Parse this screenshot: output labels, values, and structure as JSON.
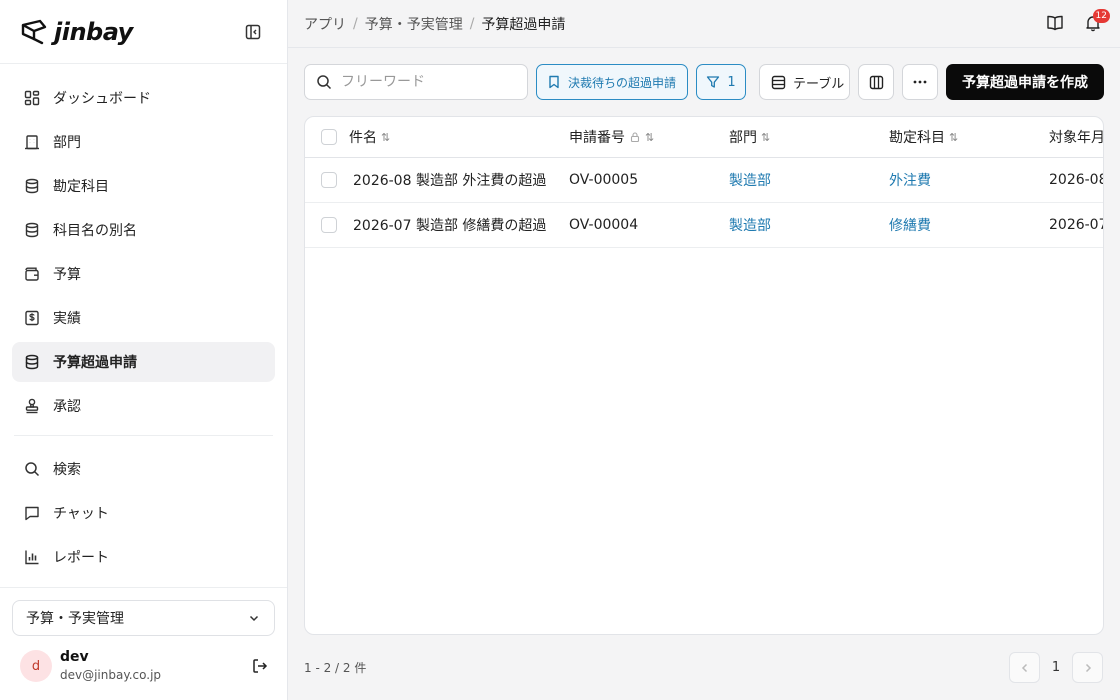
{
  "app": {
    "logo_text": "jinbay"
  },
  "sidebar": {
    "items": [
      {
        "label": "ダッシュボード",
        "icon": "dashboard-icon"
      },
      {
        "label": "部門",
        "icon": "building-icon"
      },
      {
        "label": "勘定科目",
        "icon": "database-icon"
      },
      {
        "label": "科目名の別名",
        "icon": "database-icon"
      },
      {
        "label": "予算",
        "icon": "wallet-icon"
      },
      {
        "label": "実績",
        "icon": "receipt-icon"
      },
      {
        "label": "予算超過申請",
        "icon": "database-icon",
        "active": true
      },
      {
        "label": "承認",
        "icon": "stamp-icon"
      }
    ],
    "tools": [
      {
        "label": "検索",
        "icon": "search-icon"
      },
      {
        "label": "チャット",
        "icon": "chat-icon"
      },
      {
        "label": "レポート",
        "icon": "bar-chart-icon"
      }
    ],
    "app_selector": "予算・予実管理",
    "user": {
      "initial": "d",
      "name": "dev",
      "email": "dev@jinbay.co.jp"
    }
  },
  "breadcrumb": [
    "アプリ",
    "予算・予実管理",
    "予算超過申請"
  ],
  "notifications": {
    "count": "12"
  },
  "toolbar": {
    "search_placeholder": "フリーワード",
    "saved_filter_label": "決裁待ちの超過申請",
    "filter_count": "1",
    "view_label": "テーブル",
    "create_label": "予算超過申請を作成"
  },
  "table": {
    "columns": [
      "件名",
      "申請番号",
      "部門",
      "勘定科目",
      "対象年月"
    ],
    "rows": [
      {
        "title": "2026-08 製造部 外注費の超過",
        "number": "OV-00005",
        "dept": "製造部",
        "account": "外注費",
        "month": "2026-08"
      },
      {
        "title": "2026-07 製造部 修繕費の超過",
        "number": "OV-00004",
        "dept": "製造部",
        "account": "修繕費",
        "month": "2026-07"
      }
    ]
  },
  "footer": {
    "count_text": "1 - 2 / 2 件",
    "page": "1"
  }
}
